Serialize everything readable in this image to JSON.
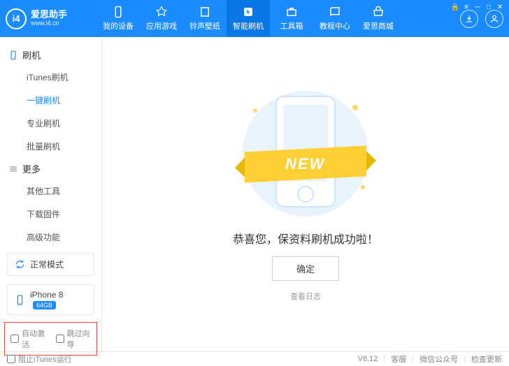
{
  "app": {
    "name": "爱思助手",
    "url": "www.i4.cn"
  },
  "nav": [
    {
      "label": "我的设备"
    },
    {
      "label": "应用游戏"
    },
    {
      "label": "铃声壁纸"
    },
    {
      "label": "智能刷机"
    },
    {
      "label": "工具箱"
    },
    {
      "label": "教程中心"
    },
    {
      "label": "爱思商城"
    }
  ],
  "sidebar": {
    "g1": {
      "title": "刷机",
      "items": [
        "iTunes刷机",
        "一键刷机",
        "专业刷机",
        "批量刷机"
      ]
    },
    "g2": {
      "title": "更多",
      "items": [
        "其他工具",
        "下载固件",
        "高级功能"
      ]
    },
    "mode": "正常模式",
    "device": {
      "name": "iPhone 8",
      "storage": "64GB"
    },
    "opts": {
      "auto": "自动激活",
      "skip": "跳过向导"
    }
  },
  "main": {
    "ribbon": "NEW",
    "msg": "恭喜您，保资料刷机成功啦！",
    "ok": "确定",
    "log": "查看日志"
  },
  "footer": {
    "block": "阻止iTunes运行",
    "ver": "V8.12",
    "svc": "客服",
    "wx": "微信公众号",
    "upd": "检查更新"
  }
}
